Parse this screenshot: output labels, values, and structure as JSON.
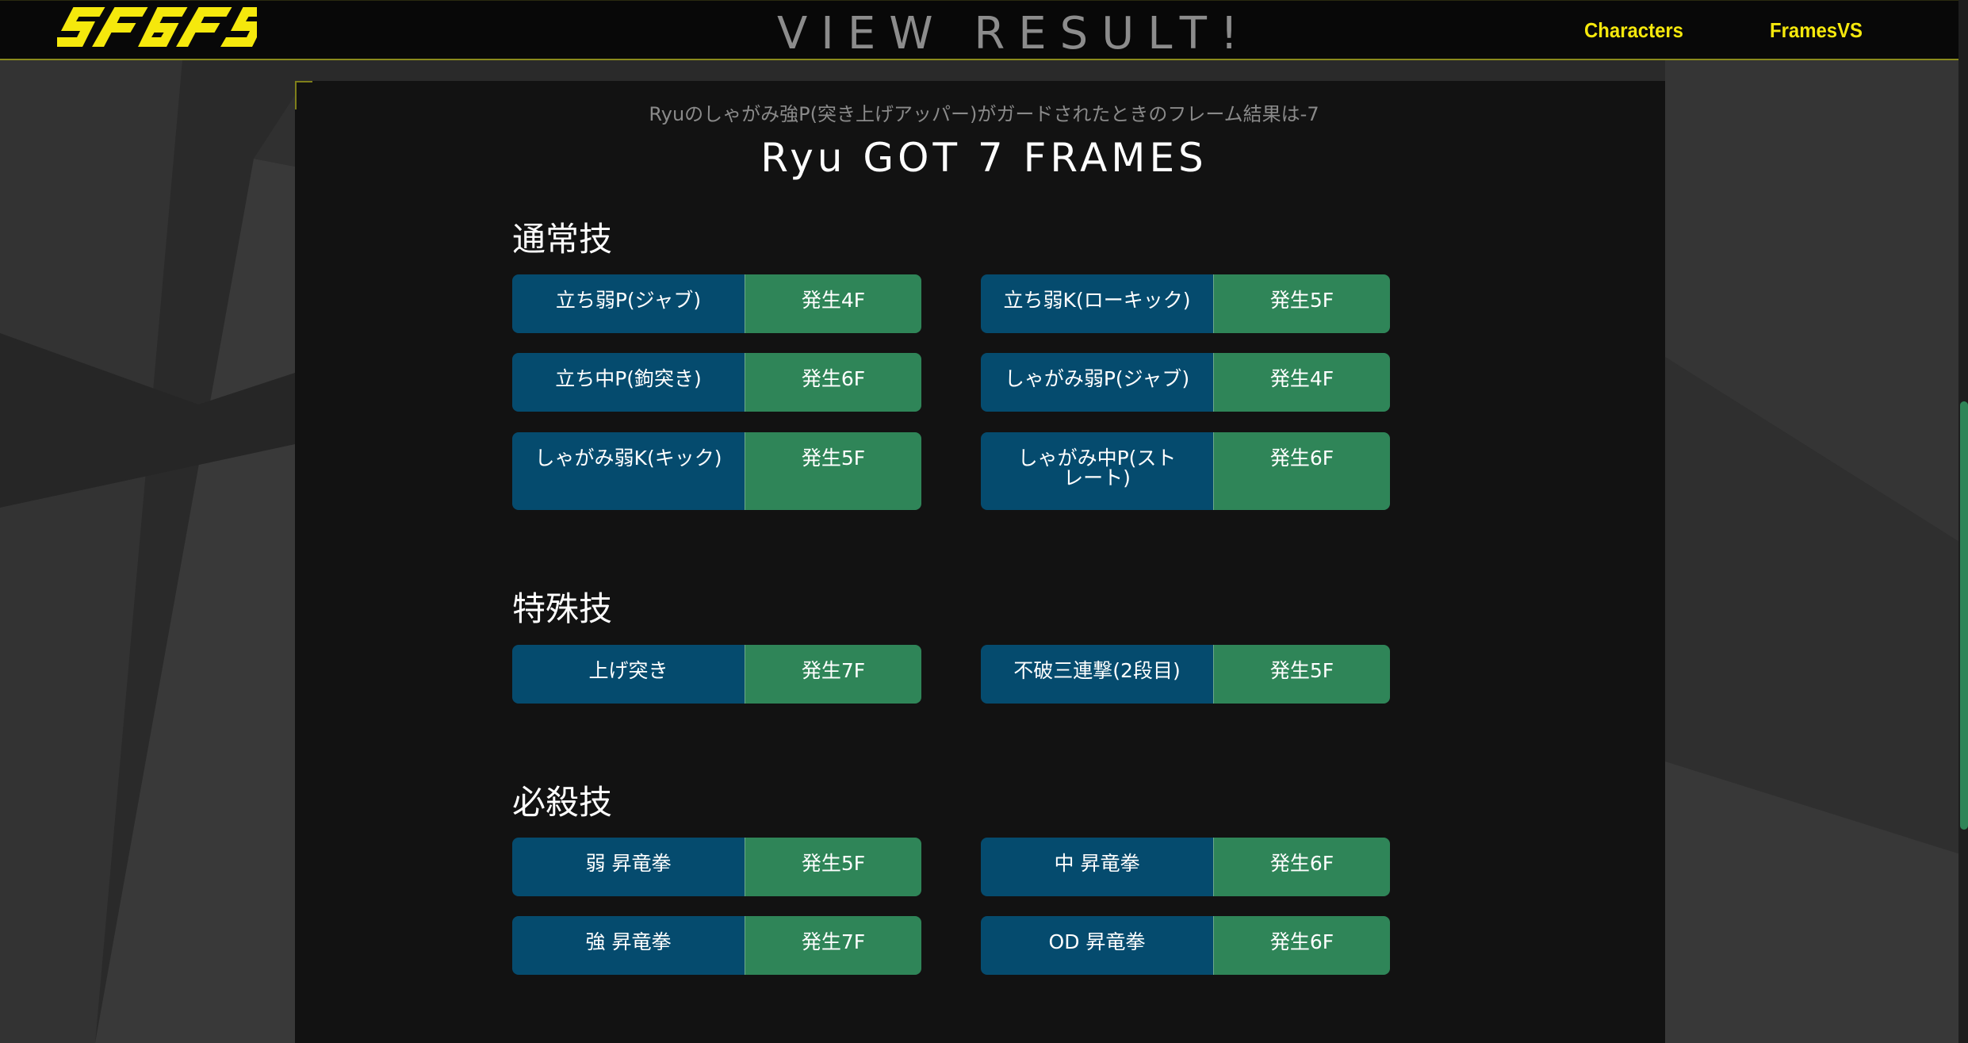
{
  "header": {
    "logo_text": "SF6FS",
    "title": "VIEW RESULT!",
    "nav": {
      "characters": "Characters",
      "framesvs": "FramesVS"
    }
  },
  "result": {
    "subtitle": "Ryuのしゃがみ強P(突き上げアッパー)がガードされたときのフレーム結果は-7",
    "title": "Ryu GOT 7 FRAMES"
  },
  "sections": [
    {
      "title": "通常技",
      "moves": [
        {
          "name": "立ち弱P(ジャブ)",
          "frame": "発生4F"
        },
        {
          "name": "立ち弱K(ローキック)",
          "frame": "発生5F"
        },
        {
          "name": "立ち中P(鉤突き)",
          "frame": "発生6F"
        },
        {
          "name": "しゃがみ弱P(ジャブ)",
          "frame": "発生4F"
        },
        {
          "name": "しゃがみ弱K(キック)",
          "frame": "発生5F"
        },
        {
          "name": "しゃがみ中P(ストレート)",
          "frame": "発生6F"
        }
      ]
    },
    {
      "title": "特殊技",
      "moves": [
        {
          "name": "上げ突き",
          "frame": "発生7F"
        },
        {
          "name": "不破三連撃(2段目)",
          "frame": "発生5F"
        }
      ]
    },
    {
      "title": "必殺技",
      "moves": [
        {
          "name": "弱 昇竜拳",
          "frame": "発生5F"
        },
        {
          "name": "中 昇竜拳",
          "frame": "発生6F"
        },
        {
          "name": "強 昇竜拳",
          "frame": "発生7F"
        },
        {
          "name": "OD 昇竜拳",
          "frame": "発生6F"
        }
      ]
    }
  ],
  "colors": {
    "accent": "#f5e80c",
    "move_name_bg": "#054b6e",
    "move_frame_bg": "#2f8558",
    "panel_bg": "#121212",
    "header_bg": "#080808"
  }
}
